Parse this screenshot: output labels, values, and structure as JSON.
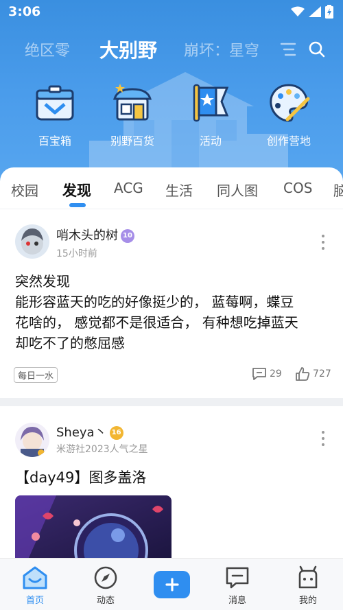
{
  "status_bar": {
    "time": "3:06"
  },
  "game_tabs": [
    {
      "label": "绝区零"
    },
    {
      "label": "大别野",
      "active": true
    },
    {
      "label": "崩坏：星穹"
    }
  ],
  "header_icons": [
    "filter-icon",
    "search-icon"
  ],
  "shortcuts": [
    {
      "label": "百宝箱",
      "icon": "treasure-box-icon"
    },
    {
      "label": "别野百货",
      "icon": "shop-icon"
    },
    {
      "label": "活动",
      "icon": "event-flag-icon"
    },
    {
      "label": "创作营地",
      "icon": "palette-icon"
    }
  ],
  "category_tabs": [
    {
      "label": "校园"
    },
    {
      "label": "发现",
      "active": true
    },
    {
      "label": "ACG"
    },
    {
      "label": "生活"
    },
    {
      "label": "同人图"
    },
    {
      "label": "COS"
    },
    {
      "label": "脑"
    }
  ],
  "posts": [
    {
      "username": "哨木头的树",
      "level": "10",
      "meta": "15小时前",
      "lines": [
        "突然发现",
        "能形容蓝天的吃的好像挺少的， 蓝莓啊，蝶豆",
        "花啥的， 感觉都不是很适合， 有种想吃掉蓝天",
        "却吃不了的憋屈感"
      ],
      "tag": "每日一水",
      "comments": "29",
      "likes": "727"
    },
    {
      "username": "Sheya丶",
      "level": "16",
      "meta": "米游社2023人气之星",
      "title": "【day49】图多盖洛"
    }
  ],
  "bottom_nav": [
    {
      "label": "首页",
      "icon": "home-icon",
      "active": true
    },
    {
      "label": "动态",
      "icon": "compass-icon"
    },
    {
      "label": "",
      "icon": "add-icon"
    },
    {
      "label": "消息",
      "icon": "message-icon"
    },
    {
      "label": "我的",
      "icon": "profile-icon"
    }
  ],
  "colors": {
    "accent": "#2f8ef0",
    "header": "#4a9ceb",
    "level10": "#a68ee8",
    "level16": "#f2b632"
  }
}
